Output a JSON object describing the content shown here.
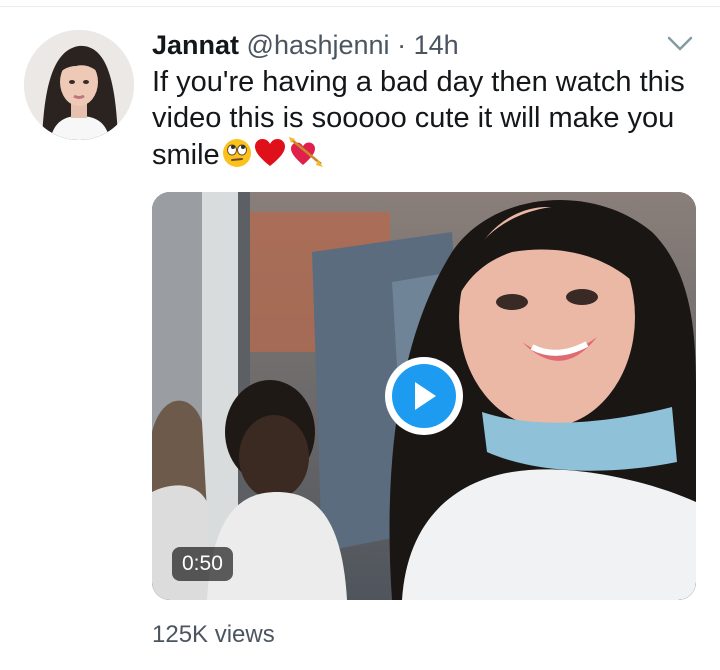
{
  "tweet": {
    "author_name": "Jannat",
    "author_handle": "@hashjenni",
    "separator": "·",
    "time": "14h",
    "text": "If you're having a bad day then watch this video this is sooooo cute it will make you smile",
    "emojis": [
      "face-with-rolling-eyes-emoji",
      "red-heart-emoji",
      "heart-with-arrow-emoji"
    ],
    "views": "125K views"
  },
  "video": {
    "duration": "0:50",
    "play_icon": "play-icon"
  },
  "menu": {
    "icon": "chevron-down-icon"
  },
  "colors": {
    "accent": "#1d9bf0",
    "text": "#14171a",
    "secondary_text": "#4b5560"
  }
}
